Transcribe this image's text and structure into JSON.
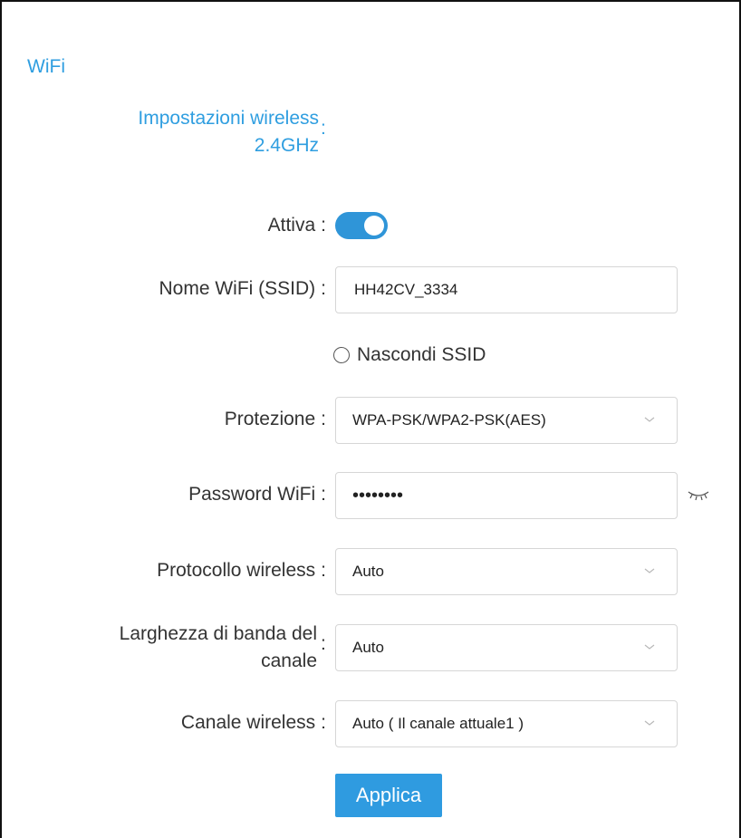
{
  "section": {
    "title": "WiFi",
    "subsection_line1": "Impostazioni wireless",
    "subsection_line2": "2.4GHz",
    "subsection_colon": ":"
  },
  "colors": {
    "accent": "#2f9ee0",
    "toggle_on": "#2f95d8",
    "button": "#2f9be0",
    "label_text": "#333333",
    "field_border": "#d6d6d6"
  },
  "fields": {
    "enable": {
      "label": "Attiva",
      "colon": ":",
      "value": true
    },
    "ssid": {
      "label": "Nome WiFi (SSID)",
      "colon": ":",
      "value": "HH42CV_3334"
    },
    "hide_ssid": {
      "label": "Nascondi SSID",
      "checked": false
    },
    "security": {
      "label": "Protezione",
      "colon": ":",
      "value": "WPA-PSK/WPA2-PSK(AES)",
      "icon": "chevron-down-icon"
    },
    "password": {
      "label": "Password WiFi",
      "colon": ":",
      "value": "••••••••",
      "toggle_icon": "eye-closed-icon"
    },
    "wireless_protocol": {
      "label": "Protocollo wireless",
      "colon": ":",
      "value": "Auto",
      "icon": "chevron-down-icon"
    },
    "channel_bandwidth": {
      "label_line1": "Larghezza di banda del",
      "label_line2": "canale",
      "colon": ":",
      "value": "Auto",
      "icon": "chevron-down-icon"
    },
    "wireless_channel": {
      "label": "Canale wireless",
      "colon": ":",
      "value": "Auto ( Il canale attuale1 )",
      "icon": "chevron-down-icon"
    }
  },
  "actions": {
    "apply_label": "Applica"
  }
}
